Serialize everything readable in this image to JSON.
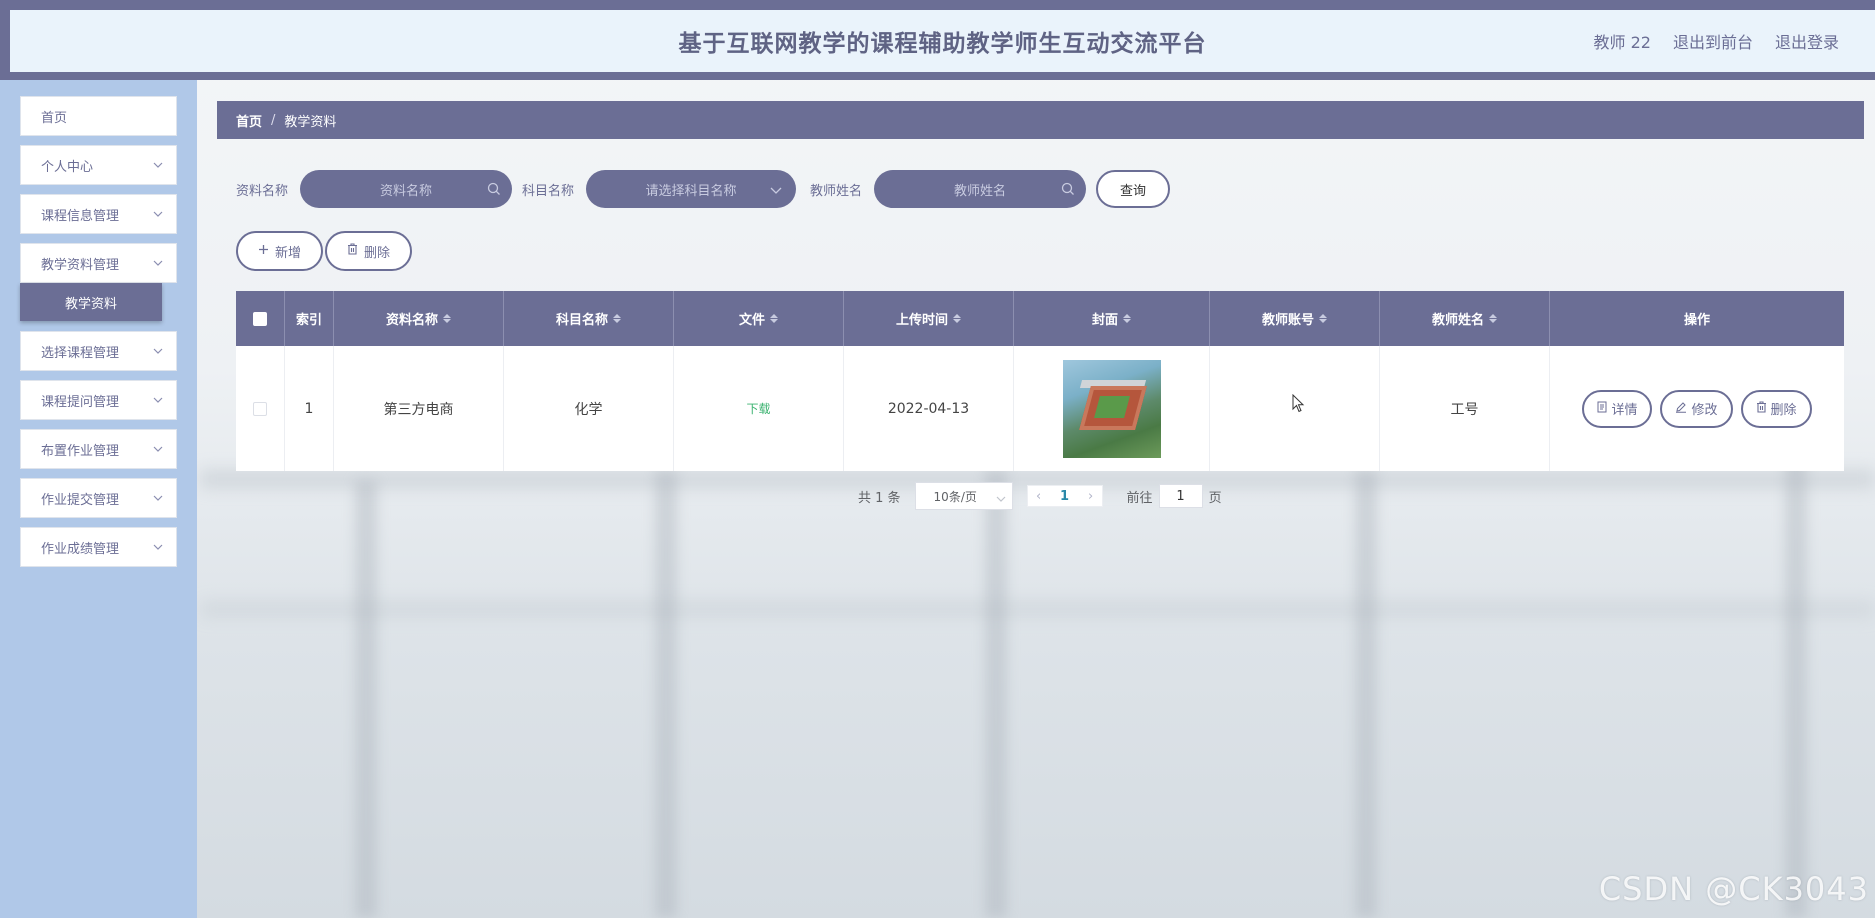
{
  "header": {
    "title": "基于互联网教学的课程辅助教学师生互动交流平台",
    "user": "教师 22",
    "exit_front": "退出到前台",
    "logout": "退出登录"
  },
  "sidebar": {
    "items": [
      {
        "label": "首页",
        "has_arrow": false
      },
      {
        "label": "个人中心",
        "has_arrow": true
      },
      {
        "label": "课程信息管理",
        "has_arrow": true
      },
      {
        "label": "教学资料管理",
        "has_arrow": true,
        "expanded": true
      },
      {
        "label": "选择课程管理",
        "has_arrow": true
      },
      {
        "label": "课程提问管理",
        "has_arrow": true
      },
      {
        "label": "布置作业管理",
        "has_arrow": true
      },
      {
        "label": "作业提交管理",
        "has_arrow": true
      },
      {
        "label": "作业成绩管理",
        "has_arrow": true
      }
    ],
    "submenu": {
      "label": "教学资料"
    }
  },
  "breadcrumb": {
    "home": "首页",
    "separator": "/",
    "current": "教学资料"
  },
  "search": {
    "name_label": "资料名称",
    "name_placeholder": "资料名称",
    "subject_label": "科目名称",
    "subject_placeholder": "请选择科目名称",
    "teacher_label": "教师姓名",
    "teacher_placeholder": "教师姓名",
    "query_label": "查询"
  },
  "actions": {
    "add_label": "新增",
    "delete_label": "删除"
  },
  "table": {
    "columns": [
      "索引",
      "资料名称",
      "科目名称",
      "文件",
      "上传时间",
      "封面",
      "教师账号",
      "教师姓名",
      "操作"
    ],
    "rows": [
      {
        "index": "1",
        "name": "第三方电商",
        "subject": "化学",
        "file": "下载",
        "upload_time": "2022-04-13",
        "teacher_account": "",
        "teacher_name": "工号",
        "ops": {
          "detail": "详情",
          "edit": "修改",
          "delete": "删除"
        }
      }
    ]
  },
  "pagination": {
    "total": "共 1 条",
    "page_size": "10条/页",
    "current_page": "1",
    "goto_label": "前往",
    "goto_value": "1",
    "page_suffix": "页"
  },
  "watermark": "CSDN @CK3043",
  "colors": {
    "primary": "#6b6e95",
    "sidebar_bg": "#b0c8e8",
    "header_bg": "#eaf3fb",
    "download": "#3cb371"
  }
}
